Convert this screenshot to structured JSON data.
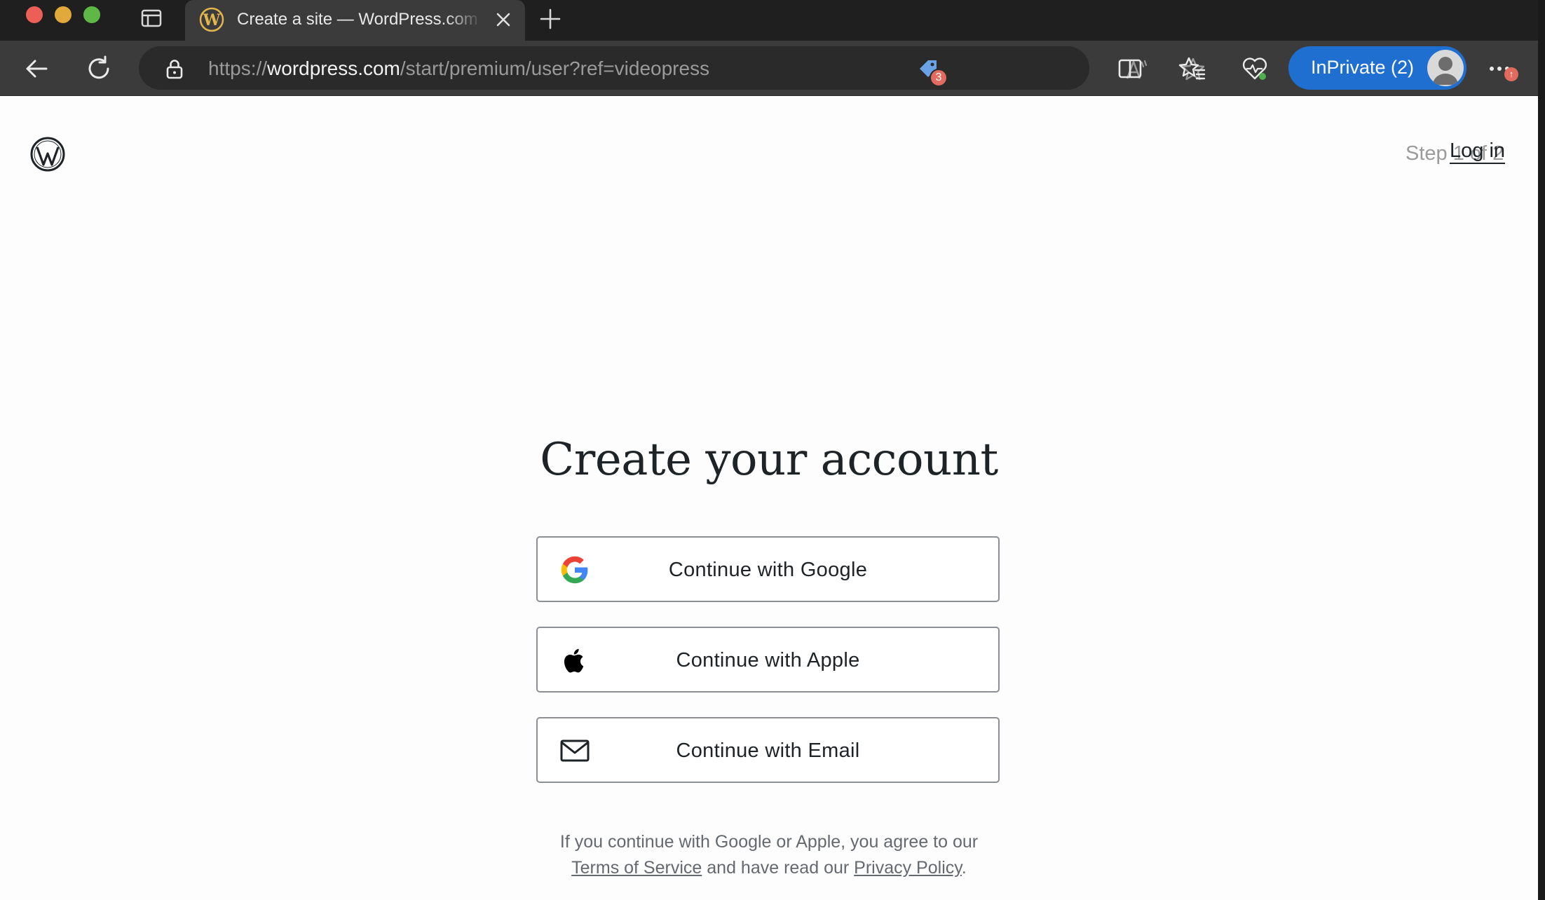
{
  "browser": {
    "tab": {
      "title": "Create a site — WordPress.com"
    },
    "address_bar": {
      "scheme": "https://",
      "host": "wordpress.com",
      "path": "/start/premium/user?ref=videopress"
    },
    "extensions_badge": "3",
    "inprivate_label": "InPrivate (2)",
    "more_badge": "↑"
  },
  "page": {
    "step_text": "Step 1 of 2",
    "login_label": "Log in",
    "heading": "Create your account",
    "buttons": {
      "google": "Continue with Google",
      "apple": "Continue with Apple",
      "email": "Continue with Email"
    },
    "disclaimer": {
      "line1": "If you continue with Google or Apple, you agree to our",
      "terms_link": "Terms of Service",
      "middle": "and have read our",
      "privacy_link": "Privacy Policy",
      "end": "."
    }
  },
  "colors": {
    "accent": "#1f6fd1",
    "tabbar_bg": "#1f1f1f",
    "toolbar_bg": "#3b3b3b",
    "text_primary": "#1d2327",
    "text_muted": "#646970"
  }
}
